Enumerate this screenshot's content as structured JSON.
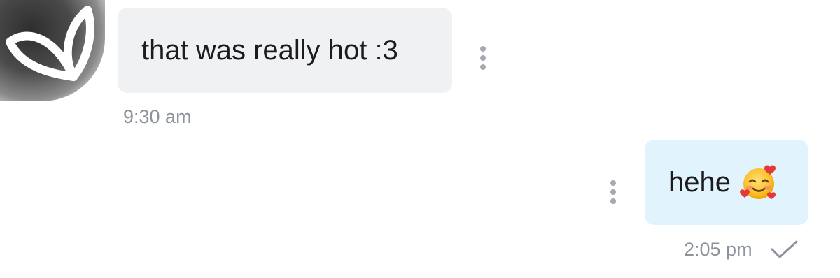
{
  "messages": [
    {
      "direction": "incoming",
      "text": "that was really hot :3",
      "time": "9:30 am",
      "bubble_color": "#f0f1f3"
    },
    {
      "direction": "outgoing",
      "text": "hehe",
      "emoji": "smiling-face-with-hearts-icon",
      "time": "2:05 pm",
      "status": "sent",
      "bubble_color": "#e1f3fc"
    }
  ],
  "colors": {
    "text": "#1c1c1e",
    "timestamp": "#8d939c",
    "menu_dots": "#a5a9b0"
  }
}
